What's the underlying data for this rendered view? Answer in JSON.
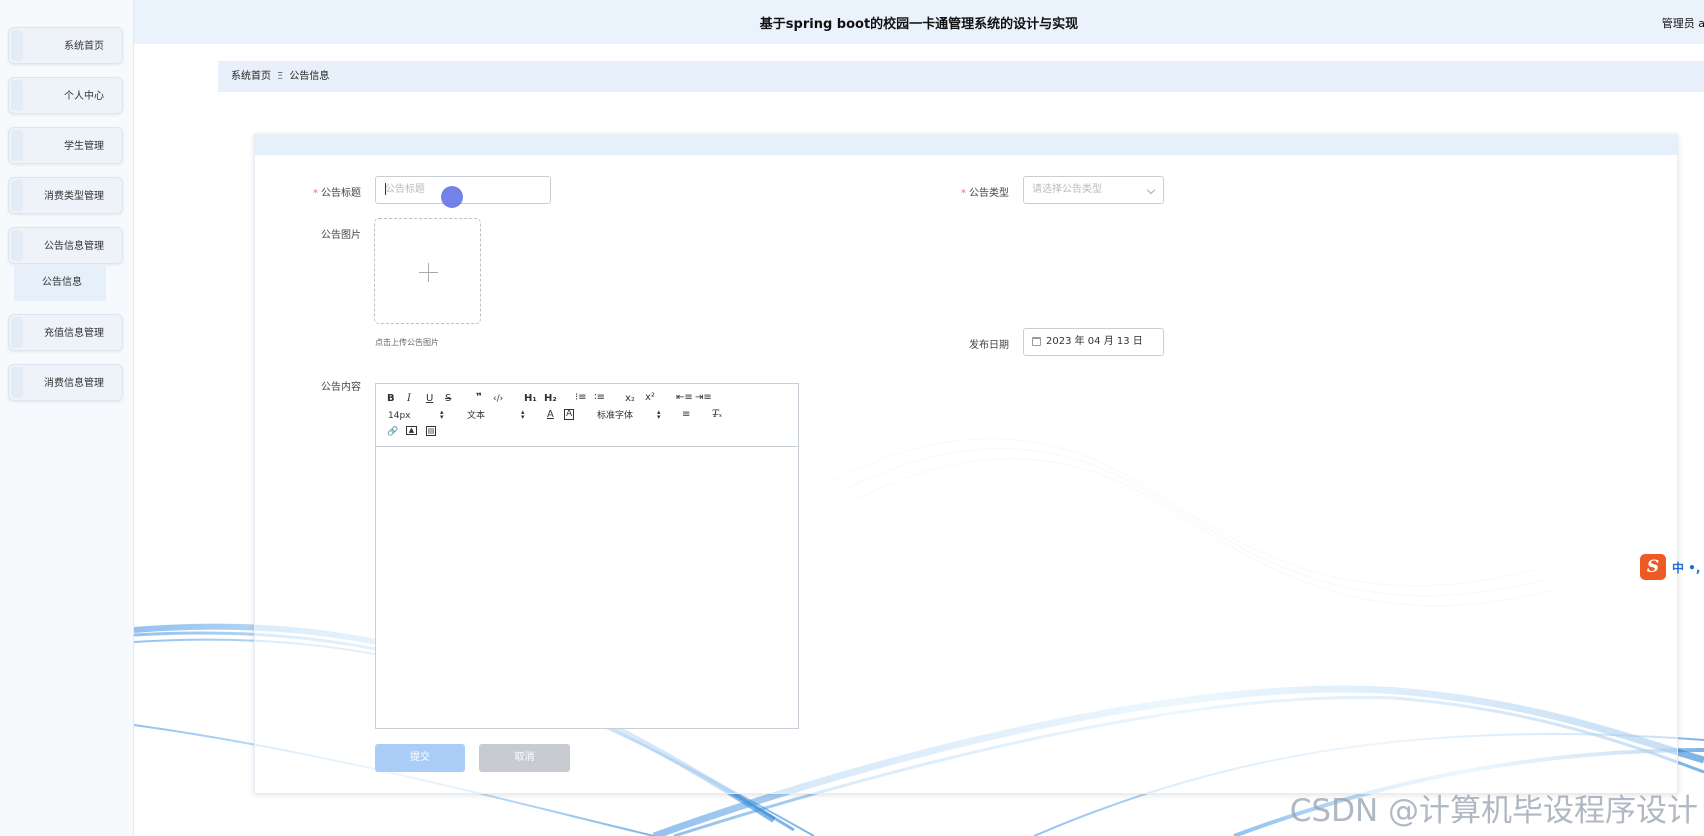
{
  "header": {
    "title": "基于spring boot的校园一卡通管理系统的设计与实现",
    "user": "管理员 ad"
  },
  "sidebar": {
    "items": [
      {
        "label": "系统首页"
      },
      {
        "label": "个人中心"
      },
      {
        "label": "学生管理"
      },
      {
        "label": "消费类型管理"
      },
      {
        "label": "公告信息管理"
      },
      {
        "label": "充值信息管理"
      },
      {
        "label": "消费信息管理"
      }
    ],
    "submenu": {
      "label": "公告信息"
    }
  },
  "breadcrumb": {
    "home": "系统首页",
    "separator": "Ξ",
    "current": "公告信息"
  },
  "form": {
    "title_label": "公告标题",
    "title_placeholder": "公告标题",
    "type_label": "公告类型",
    "type_placeholder": "请选择公告类型",
    "image_label": "公告图片",
    "upload_tip": "点击上传公告图片",
    "date_label": "发布日期",
    "date_value": "2023 年 04 月 13 日",
    "content_label": "公告内容",
    "required_mark": "*"
  },
  "editor": {
    "font_size": "14px",
    "header_select": "文本",
    "font_family": "标准字体",
    "toolbar_buttons": [
      "bold",
      "italic",
      "underline",
      "strike",
      "blockquote",
      "code-block",
      "header-1",
      "header-2",
      "ordered-list",
      "bullet-list",
      "subscript",
      "superscript",
      "outdent",
      "indent",
      "color",
      "background",
      "align",
      "clean",
      "link",
      "image",
      "video"
    ]
  },
  "buttons": {
    "submit": "提交",
    "cancel": "取消"
  },
  "ime": {
    "text": "中 •,"
  },
  "watermark": "CSDN @计算机毕设程序设计",
  "colors": {
    "header_bg": "#eaf3fc",
    "primary_button": "#a9cdf7",
    "required": "#f56c6c",
    "cursor": "#6474e6"
  }
}
